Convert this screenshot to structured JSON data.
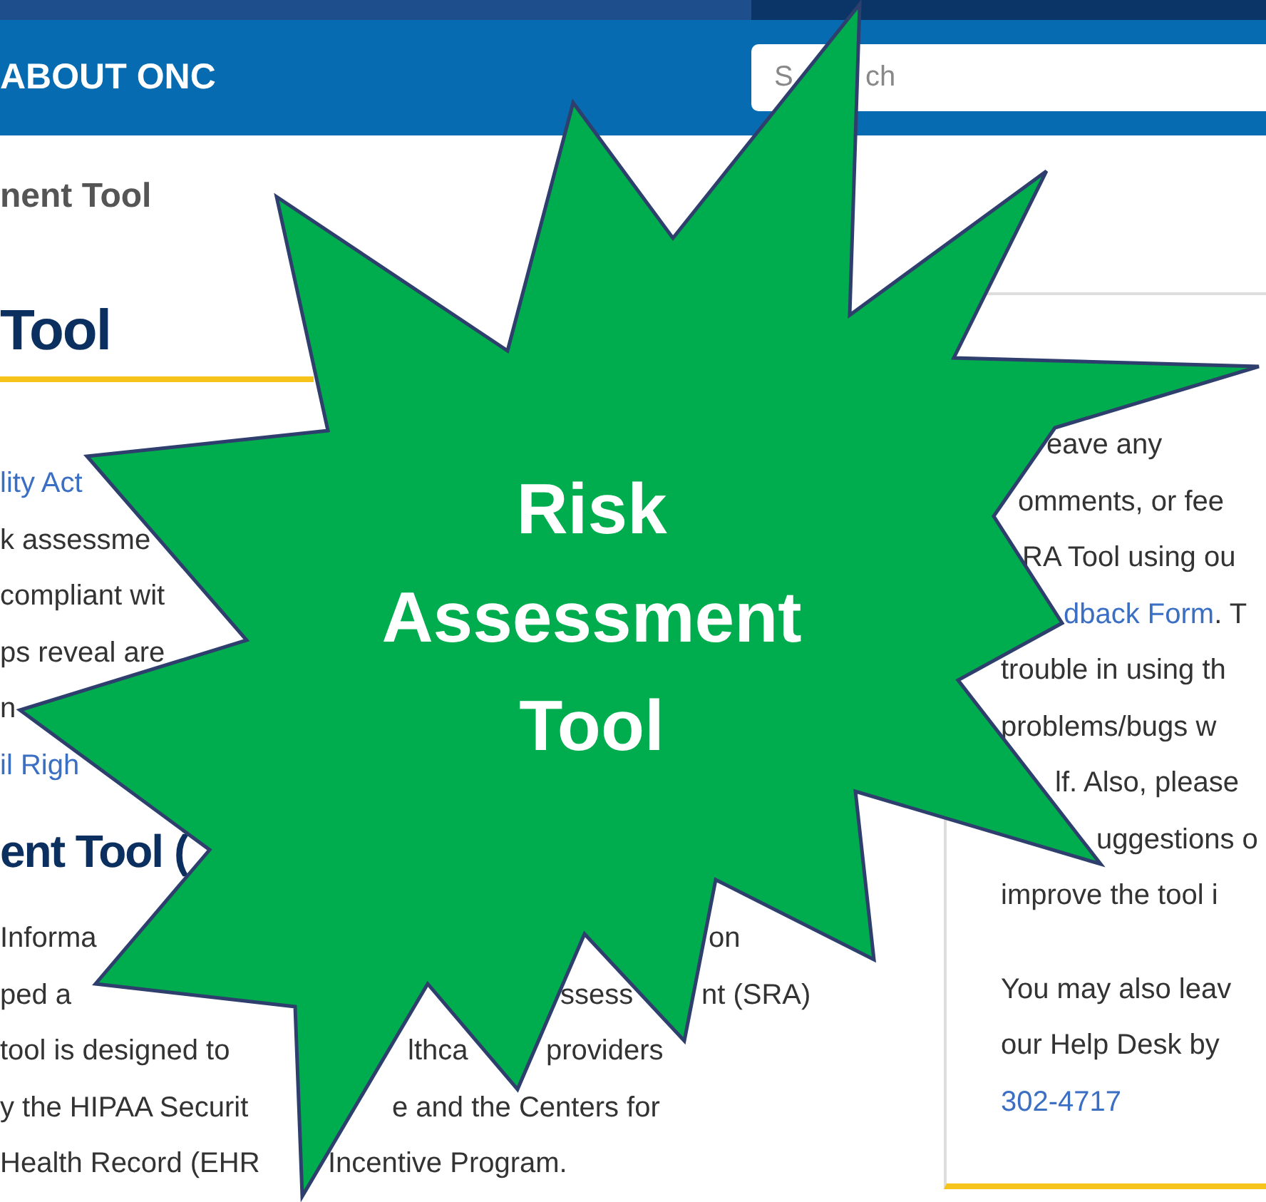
{
  "top_nav": {
    "item": "ABOUT ONC",
    "search": {
      "placeholder": "S",
      "placeholder_end": "ch"
    }
  },
  "breadcrumb": "nent Tool",
  "heading": "Tool",
  "intro_lines": [
    [
      {
        "text": "lity Act",
        "link": true
      }
    ],
    [
      {
        "text": "k assessme",
        "link": false
      }
    ],
    [
      {
        "text": "compliant wit",
        "link": false
      }
    ],
    [
      {
        "text": "ps reveal are",
        "link": false
      }
    ],
    [
      {
        "text": "n",
        "link": false
      }
    ],
    [
      {
        "text": "il Righ",
        "link": true
      }
    ]
  ],
  "section_heading": "ent Tool (",
  "body_lines": [
    [
      {
        "text": "Informa",
        "link": false
      },
      {
        "text": "on",
        "link": false
      }
    ],
    [
      {
        "text": "ped a",
        "link": false
      },
      {
        "text": "ssess",
        "link": false
      },
      {
        "text": "nt (SRA)",
        "link": false
      }
    ],
    [
      {
        "text": "tool is designed to",
        "link": false
      },
      {
        "text": "lthca",
        "link": false
      },
      {
        "text": "providers",
        "link": false
      }
    ],
    [
      {
        "text": "y the HIPAA Securit",
        "link": false
      },
      {
        "text": "e and the Centers for",
        "link": false
      }
    ],
    [
      {
        "text": "Health Record (EHR",
        "link": false
      },
      {
        "text": "Incentive Program.",
        "link": false
      }
    ]
  ],
  "help_card": {
    "paragraphs": [
      [
        [
          {
            "text": "eave any",
            "link": false
          }
        ],
        [
          {
            "text": "omments, or fee",
            "link": false
          }
        ],
        [
          {
            "text": "RA Tool using ou",
            "link": false
          }
        ],
        [
          {
            "text": "dback Form",
            "link": true
          },
          {
            "text": ". T",
            "link": false
          }
        ],
        [
          {
            "text": "trouble in using th",
            "link": false
          }
        ],
        [
          {
            "text": "problems/bugs w",
            "link": false
          }
        ],
        [
          {
            "text": "lf. Also, please",
            "link": false
          }
        ],
        [
          {
            "text": "uggestions o",
            "link": false
          }
        ],
        [
          {
            "text": "improve the tool i",
            "link": false
          }
        ]
      ],
      [
        [
          {
            "text": "You may also leav",
            "link": false
          }
        ],
        [
          {
            "text": "our Help Desk by",
            "link": false
          }
        ],
        [
          {
            "text": "302-4717",
            "link": true
          }
        ]
      ]
    ]
  },
  "overlay": {
    "title": "Risk Assessment Tool"
  }
}
